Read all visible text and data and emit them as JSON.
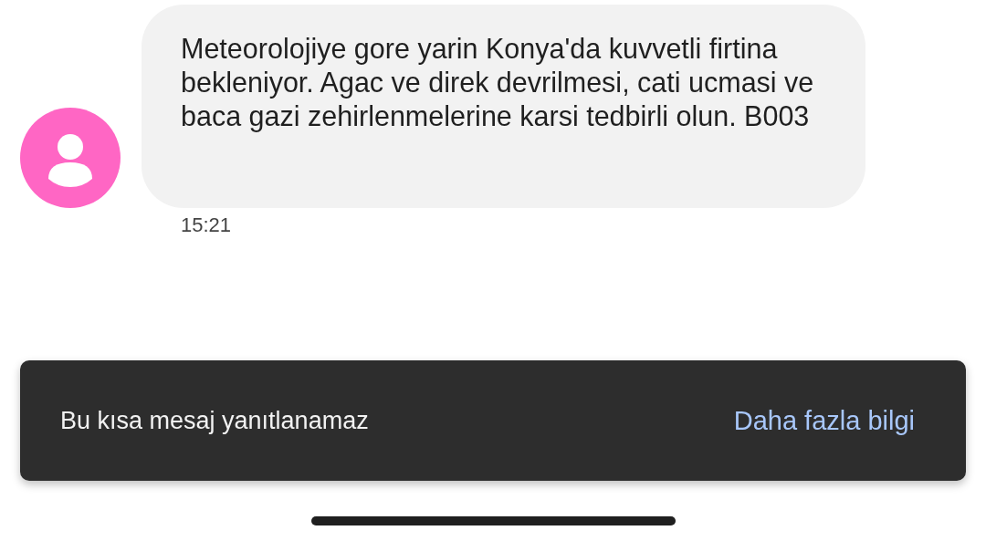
{
  "message": {
    "text": "Meteorolojiye gore yarin Konya'da kuvvetli firtina bekleniyor. Agac ve direk devrilmesi, cati ucmasi ve baca gazi zehirlenmelerine karsi tedbirli olun. B003",
    "time": "15:21"
  },
  "snackbar": {
    "text": "Bu kısa mesaj yanıtlanamaz",
    "action": "Daha fazla bilgi"
  }
}
